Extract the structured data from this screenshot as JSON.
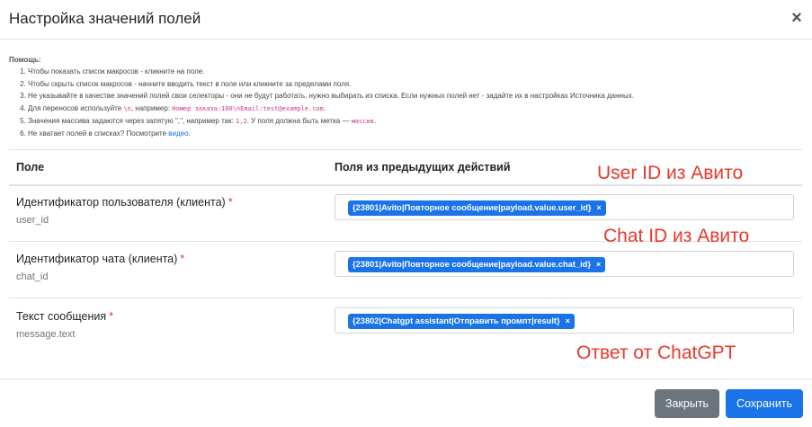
{
  "modal": {
    "title": "Настройка значений полей"
  },
  "help": {
    "title": "Помощь:",
    "items": {
      "i1": "Чтобы показать список макросов - кликните на поле.",
      "i2": "Чтобы скрыть список макросов - начните вводить текст в поле или кликните за пределами поля.",
      "i3": "Не указывайте в качестве значений полей свои селекторы - они не будут работать, нужно выбирать из списка. Если нужных полей нет - задайте их в настройках Источника данных.",
      "i4_a": "Для переносов используйте",
      "i4_code1": "\\n",
      "i4_b": ", например:",
      "i4_code2": "Номер заказа:100\\nEmail:test@example.com",
      "i4_c": ".",
      "i5_a": "Значения массива задаются через запятую \",\", например так:",
      "i5_code1": "1,2",
      "i5_b": ". У поля должна быть метка —",
      "i5_code2": "массив",
      "i5_c": ".",
      "i6_a": "Не хватает полей в списках? Посмотрите",
      "i6_link": "видео",
      "i6_b": "."
    }
  },
  "table": {
    "col_field": "Поле",
    "col_values": "Поля из предыдущих действий",
    "rows": [
      {
        "label": "Идентификатор пользователя (клиента)",
        "required": "*",
        "key": "user_id",
        "tag": "{23801|Avito|Повторное сообщение|payload.value.user_id}",
        "remove": "×"
      },
      {
        "label": "Идентификатор чата (клиента)",
        "required": "*",
        "key": "chat_id",
        "tag": "{23801|Avito|Повторное сообщение|payload.value.chat_id}",
        "remove": "×"
      },
      {
        "label": "Текст сообщения",
        "required": "*",
        "key": "message.text",
        "tag": "{23802|Chatgpt assistant|Отправить промпт|result}",
        "remove": "×"
      }
    ]
  },
  "annotations": {
    "a1": "User ID из Авито",
    "a2": "Chat ID из Авито",
    "a3": "Ответ от ChatGPT"
  },
  "footer": {
    "close_label": "Закрыть",
    "save_label": "Сохранить"
  },
  "colors": {
    "accent": "#1a73e8",
    "secondary": "#6c757d",
    "annotation": "#e8392a",
    "required": "#dc3545"
  }
}
